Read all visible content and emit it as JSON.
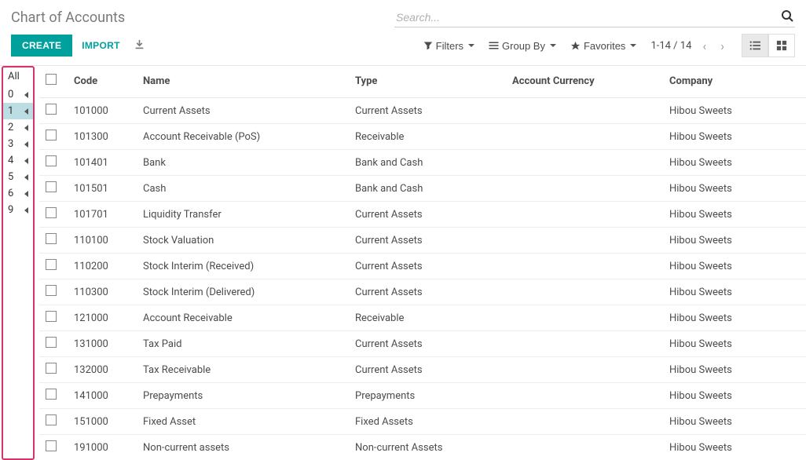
{
  "title": "Chart of Accounts",
  "search": {
    "placeholder": "Search..."
  },
  "buttons": {
    "create": "CREATE",
    "import": "IMPORT"
  },
  "filters": {
    "filters": "Filters",
    "group_by": "Group By",
    "favorites": "Favorites"
  },
  "pager": {
    "range": "1-14 / 14"
  },
  "side": {
    "all": "All",
    "items": [
      "0",
      "1",
      "2",
      "3",
      "4",
      "5",
      "6",
      "9"
    ],
    "active_index": 1
  },
  "columns": {
    "code": "Code",
    "name": "Name",
    "type": "Type",
    "currency": "Account Currency",
    "company": "Company"
  },
  "rows": [
    {
      "code": "101000",
      "name": "Current Assets",
      "type": "Current Assets",
      "currency": "",
      "company": "Hibou Sweets"
    },
    {
      "code": "101300",
      "name": "Account Receivable (PoS)",
      "type": "Receivable",
      "currency": "",
      "company": "Hibou Sweets"
    },
    {
      "code": "101401",
      "name": "Bank",
      "type": "Bank and Cash",
      "currency": "",
      "company": "Hibou Sweets"
    },
    {
      "code": "101501",
      "name": "Cash",
      "type": "Bank and Cash",
      "currency": "",
      "company": "Hibou Sweets"
    },
    {
      "code": "101701",
      "name": "Liquidity Transfer",
      "type": "Current Assets",
      "currency": "",
      "company": "Hibou Sweets"
    },
    {
      "code": "110100",
      "name": "Stock Valuation",
      "type": "Current Assets",
      "currency": "",
      "company": "Hibou Sweets"
    },
    {
      "code": "110200",
      "name": "Stock Interim (Received)",
      "type": "Current Assets",
      "currency": "",
      "company": "Hibou Sweets"
    },
    {
      "code": "110300",
      "name": "Stock Interim (Delivered)",
      "type": "Current Assets",
      "currency": "",
      "company": "Hibou Sweets"
    },
    {
      "code": "121000",
      "name": "Account Receivable",
      "type": "Receivable",
      "currency": "",
      "company": "Hibou Sweets"
    },
    {
      "code": "131000",
      "name": "Tax Paid",
      "type": "Current Assets",
      "currency": "",
      "company": "Hibou Sweets"
    },
    {
      "code": "132000",
      "name": "Tax Receivable",
      "type": "Current Assets",
      "currency": "",
      "company": "Hibou Sweets"
    },
    {
      "code": "141000",
      "name": "Prepayments",
      "type": "Prepayments",
      "currency": "",
      "company": "Hibou Sweets"
    },
    {
      "code": "151000",
      "name": "Fixed Asset",
      "type": "Fixed Assets",
      "currency": "",
      "company": "Hibou Sweets"
    },
    {
      "code": "191000",
      "name": "Non-current assets",
      "type": "Non-current Assets",
      "currency": "",
      "company": "Hibou Sweets"
    }
  ]
}
